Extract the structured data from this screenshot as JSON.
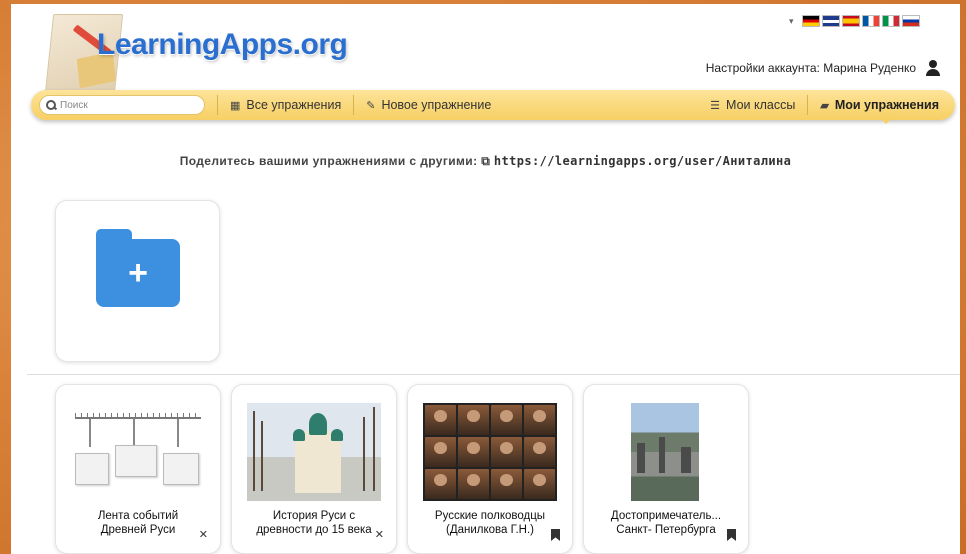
{
  "header": {
    "logo_text": "LearningApps.org",
    "lang_caret": "▾",
    "flags": [
      "de",
      "gb",
      "es",
      "fr",
      "it",
      "ru"
    ],
    "account_text": "Настройки аккаунта: Марина Руденко"
  },
  "nav": {
    "search_placeholder": "Поиск",
    "all_exercises": "Все упражнения",
    "new_exercise": "Новое упражнение",
    "my_classes": "Мои классы",
    "my_exercises": "Мои упражнения"
  },
  "share": {
    "text": "Поделитесь вашими упражнениями с другими:",
    "url": "https://learningapps.org/user/Аниталина"
  },
  "add_folder": {
    "symbol": "+"
  },
  "cards": [
    {
      "line1": "Лента событий",
      "line2": "Древней Руси",
      "mark": "eye-slash"
    },
    {
      "line1": "История Руси с",
      "line2": "древности до 15 века",
      "mark": "eye-slash"
    },
    {
      "line1": "Русские полководцы",
      "line2": "(Данилкова Г.Н.)",
      "mark": "bookmark"
    },
    {
      "line1": "Достопримечатель...",
      "line2": "Санкт- Петербурга",
      "mark": "bookmark"
    }
  ],
  "colors": {
    "nav_bg": "#f7cf63",
    "logo_blue": "#2a6fd0",
    "folder_blue": "#3d8fe0",
    "frame_bg": "#d9823a"
  }
}
